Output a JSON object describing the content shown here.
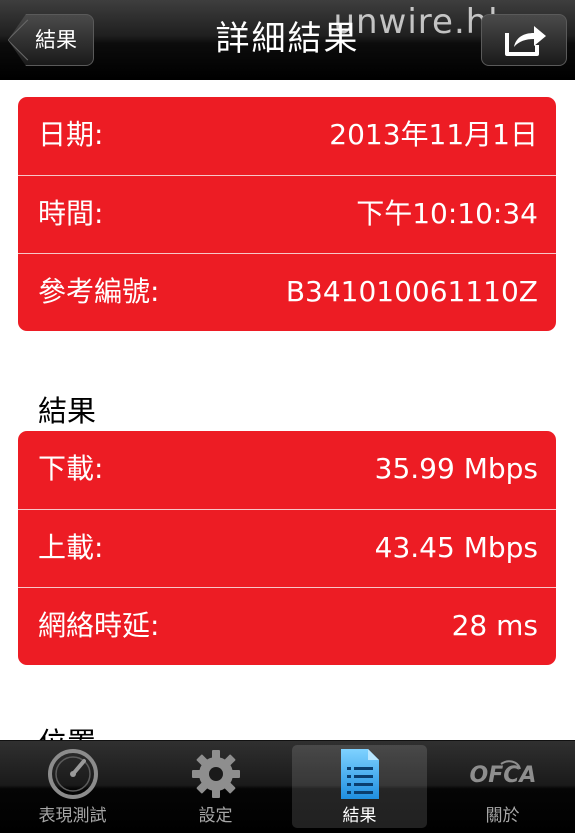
{
  "navbar": {
    "back_label": "結果",
    "title": "詳細結果",
    "watermark": "unwire.hk"
  },
  "info": {
    "rows": [
      {
        "label": "日期:",
        "value": "2013年11月1日"
      },
      {
        "label": "時間:",
        "value": "下午10:10:34"
      },
      {
        "label": "參考編號:",
        "value": "B341010061110Z"
      }
    ]
  },
  "results": {
    "header": "結果",
    "rows": [
      {
        "label": "下載:",
        "value": "35.99 Mbps"
      },
      {
        "label": "上載:",
        "value": "43.45 Mbps"
      },
      {
        "label": "網絡時延:",
        "value": "28 ms"
      }
    ]
  },
  "next_section": {
    "header": "位置"
  },
  "tabbar": {
    "tabs": [
      {
        "label": "表現測試",
        "icon": "speedometer-icon",
        "active": false
      },
      {
        "label": "設定",
        "icon": "gear-icon",
        "active": false
      },
      {
        "label": "結果",
        "icon": "document-list-icon",
        "active": true
      },
      {
        "label": "關於",
        "icon": "ofca-logo-icon",
        "active": false,
        "icon_text": "OFCA"
      }
    ]
  },
  "colors": {
    "accent_red": "#ed1c24",
    "navbar": "#000000",
    "tab_active_icon": "#35a9f0"
  }
}
